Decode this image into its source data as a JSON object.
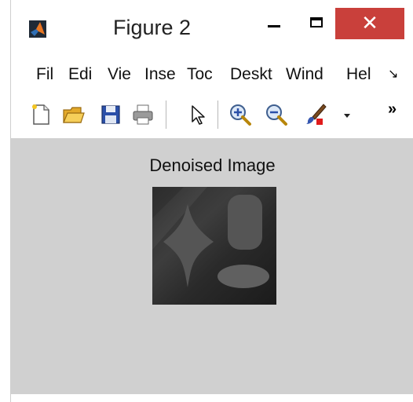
{
  "window": {
    "title": "Figure 2",
    "close_glyph": "✕",
    "icons": {
      "app": "matlab-logo-icon",
      "minimize": "minimize-icon",
      "maximize": "maximize-icon",
      "close": "close-icon"
    }
  },
  "menu": {
    "items": [
      "Fil",
      "Edi",
      "Vie",
      "Inse",
      "Toc",
      "Deskt",
      "Wind",
      "Hel"
    ],
    "overflow_glyph": "↘"
  },
  "toolbar": {
    "icons": [
      "new-figure-icon",
      "open-file-icon",
      "save-icon",
      "print-icon",
      "pointer-icon",
      "zoom-in-icon",
      "zoom-out-icon",
      "brush-icon",
      "dropdown-arrow-icon"
    ],
    "overflow_glyph": "»"
  },
  "figure": {
    "axes_title": "Denoised Image",
    "background": "#d0d0d0"
  },
  "colors": {
    "close_button": "#c9403b",
    "canvas": "#d0d0d0"
  }
}
